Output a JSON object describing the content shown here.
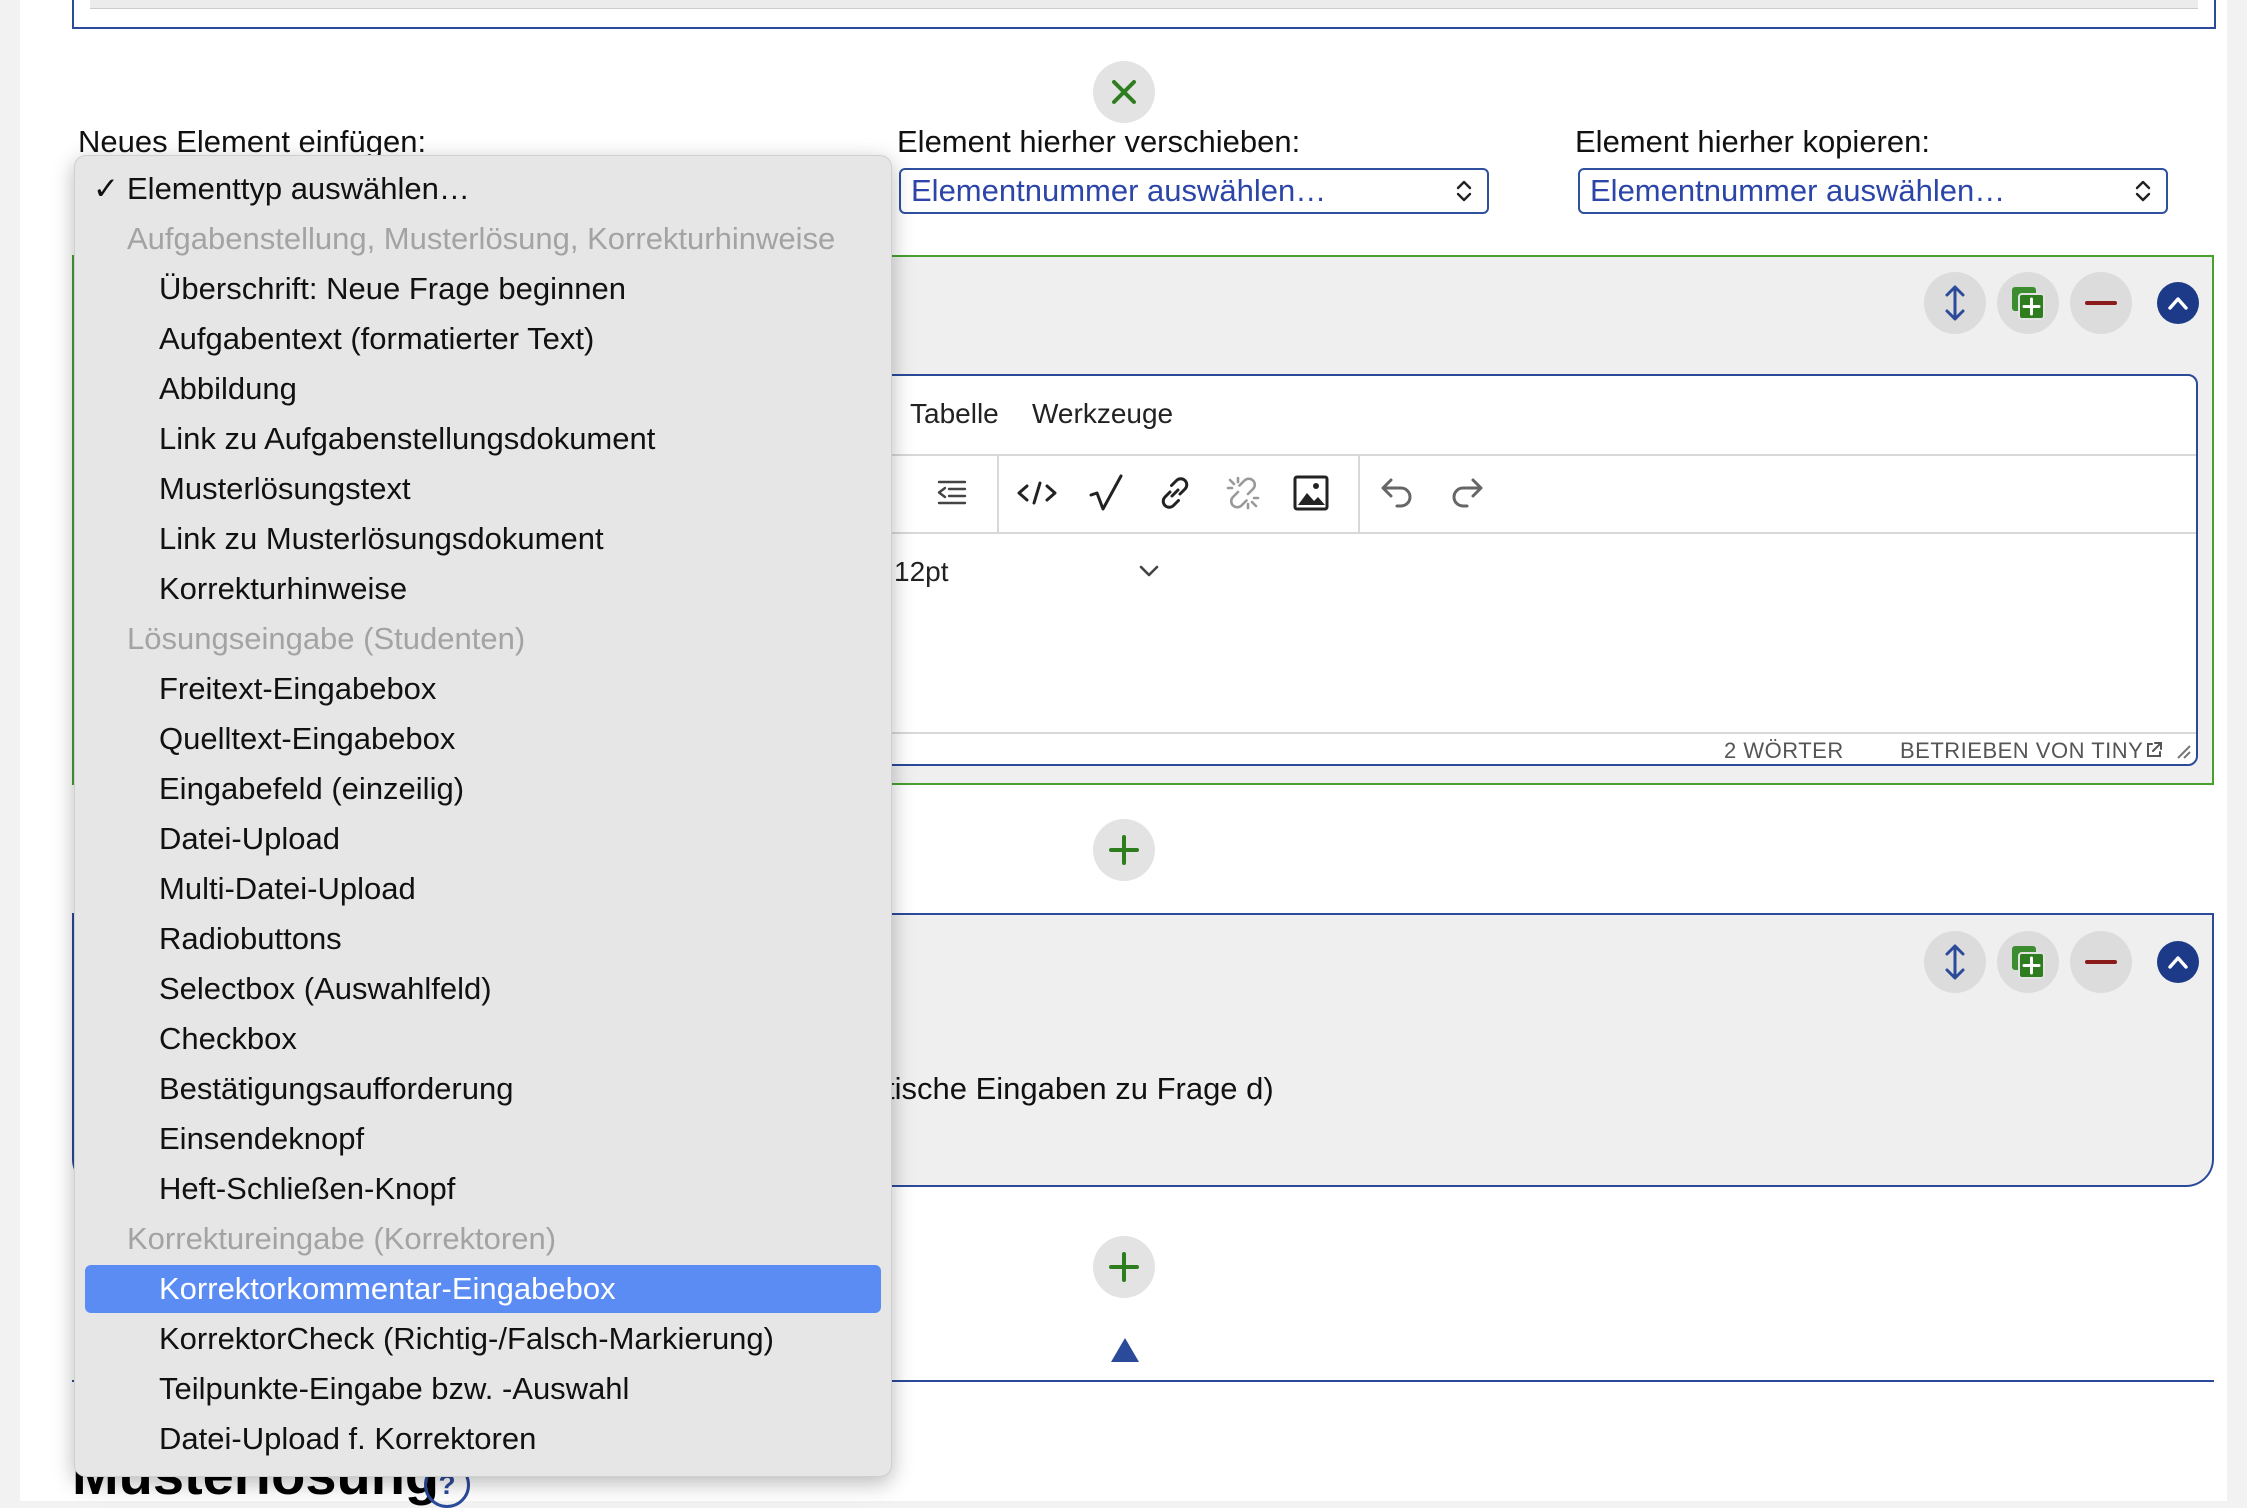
{
  "close_button": {
    "icon": "close-icon",
    "color": "#2e7d1f"
  },
  "insert": {
    "label": "Neues Element einfügen:"
  },
  "move": {
    "label": "Element hierher verschieben:",
    "select_value": "Elementnummer auswählen…"
  },
  "copy": {
    "label": "Element hierher kopieren:",
    "select_value": "Elementnummer auswählen…"
  },
  "editor": {
    "menu": [
      "Tabelle",
      "Werkzeuge"
    ],
    "font_size": "12pt",
    "word_count": "2 WÖRTER",
    "powered_by": "BETRIEBEN VON TINY"
  },
  "panel2": {
    "text_fragment": "tische Eingaben zu Frage d)"
  },
  "heading": {
    "text": "Musterlösung",
    "help": "?"
  },
  "colors": {
    "accent": "#2b4a9a",
    "green": "#47a12f",
    "selection": "#5a8cf4",
    "danger": "#8b1a1a"
  },
  "dropdown": {
    "selected_marker": "✓",
    "first": "Elementtyp auswählen…",
    "groups": [
      {
        "label": "Aufgabenstellung, Musterlösung, Korrekturhinweise",
        "options": [
          "Überschrift: Neue Frage beginnen",
          "Aufgabentext (formatierter Text)",
          "Abbildung",
          "Link zu Aufgabenstellungsdokument",
          "Musterlösungstext",
          "Link zu Musterlösungsdokument",
          "Korrekturhinweise"
        ]
      },
      {
        "label": "Lösungseingabe (Studenten)",
        "options": [
          "Freitext-Eingabebox",
          "Quelltext-Eingabebox",
          "Eingabefeld (einzeilig)",
          "Datei-Upload",
          "Multi-Datei-Upload",
          "Radiobuttons",
          "Selectbox (Auswahlfeld)",
          "Checkbox",
          "Bestätigungsaufforderung",
          "Einsendeknopf",
          "Heft-Schließen-Knopf"
        ]
      },
      {
        "label": "Korrektureingabe (Korrektoren)",
        "options": [
          "Korrektorkommentar-Eingabebox",
          "KorrektorCheck (Richtig-/Falsch-Markierung)",
          "Teilpunkte-Eingabe bzw. -Auswahl",
          "Datei-Upload f. Korrektoren"
        ]
      }
    ],
    "highlighted": "Korrektorkommentar-Eingabebox"
  }
}
